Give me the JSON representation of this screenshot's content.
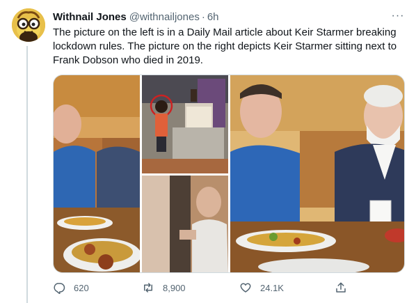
{
  "tweet": {
    "author": {
      "display_name": "Withnail Jones",
      "handle": "@withnailjones",
      "separator": "·",
      "time": "6h",
      "avatar_icon": "yellow-cartoon-glasses-avatar"
    },
    "more_label": "···",
    "text": "The picture on the left is in a Daily Mail article about Keir Starmer breaking lockdown rules. The picture on the right depicts Keir Starmer sitting next to Frank Dobson who died in 2019.",
    "media": [
      {
        "icon": "photo-man-blue-sweater-eating"
      },
      {
        "icon": "photo-woman-in-restaurant-kitchen"
      },
      {
        "icon": "photo-blurry-man-in-doorway"
      },
      {
        "icon": "photo-starmer-and-dobson-eating"
      }
    ],
    "actions": {
      "reply": {
        "icon": "reply-icon",
        "count": "620"
      },
      "retweet": {
        "icon": "retweet-icon",
        "count": "8,900"
      },
      "like": {
        "icon": "heart-icon",
        "count": "24.1K"
      },
      "share": {
        "icon": "share-icon"
      }
    }
  },
  "colors": {
    "text_primary": "#0f1419",
    "text_secondary": "#536471",
    "border": "#cfd9de",
    "avatar_bg": "#e8c04a"
  }
}
